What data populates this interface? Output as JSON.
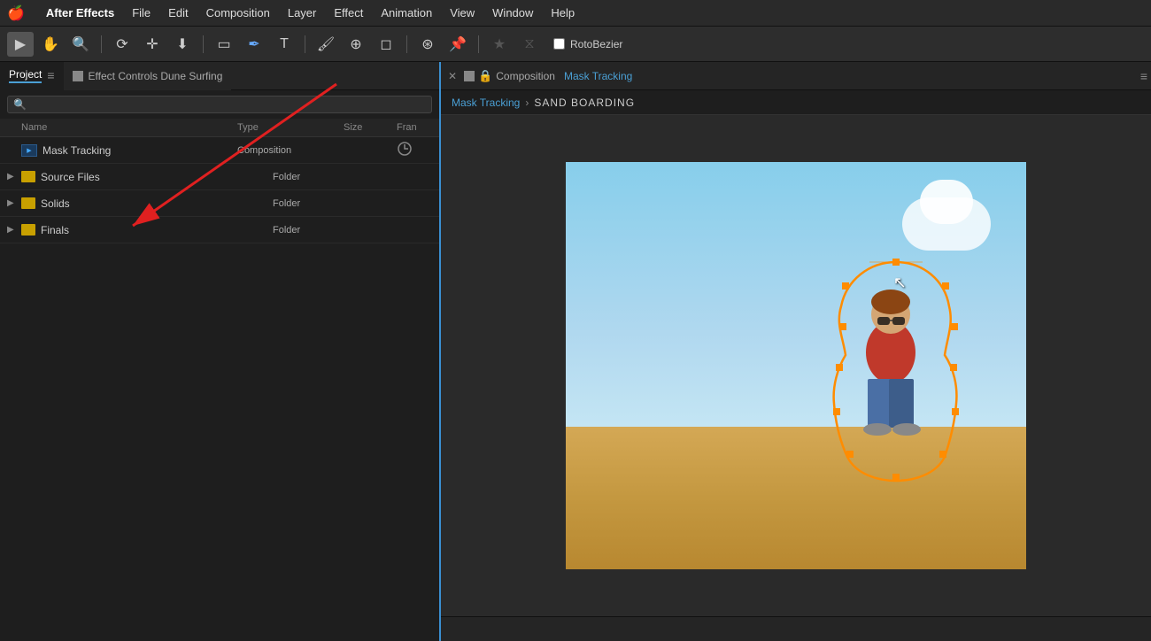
{
  "menubar": {
    "apple": "🍎",
    "items": [
      "After Effects",
      "File",
      "Edit",
      "Composition",
      "Layer",
      "Effect",
      "Animation",
      "View",
      "Window",
      "Help"
    ]
  },
  "toolbar": {
    "tools": [
      "selection",
      "hand",
      "zoom",
      "rotate",
      "move-anchor",
      "backward",
      "rect-mask",
      "pen",
      "text",
      "brush",
      "clone",
      "eraser",
      "puppet",
      "pin"
    ],
    "roto_bezier_label": "RotoBezier"
  },
  "left_panel": {
    "project_tab_label": "Project",
    "effect_controls_label": "Effect Controls Dune Surfing",
    "search_placeholder": "🔍",
    "columns": {
      "name": "Name",
      "type": "Type",
      "size": "Size",
      "fran": "Fran"
    },
    "items": [
      {
        "name": "Mask Tracking",
        "type": "Composition",
        "size": "",
        "has_icon": true,
        "icon_type": "composition",
        "expanded": false
      },
      {
        "name": "Source Files",
        "type": "Folder",
        "size": "",
        "icon_type": "folder",
        "expanded": false
      },
      {
        "name": "Solids",
        "type": "Folder",
        "size": "",
        "icon_type": "folder",
        "expanded": false
      },
      {
        "name": "Finals",
        "type": "Folder",
        "size": "",
        "icon_type": "folder",
        "expanded": false
      }
    ]
  },
  "right_panel": {
    "comp_tab_title": "Composition",
    "comp_tab_name": "Mask Tracking",
    "breadcrumb_link": "Mask Tracking",
    "breadcrumb_current": "SAND BOARDING"
  }
}
